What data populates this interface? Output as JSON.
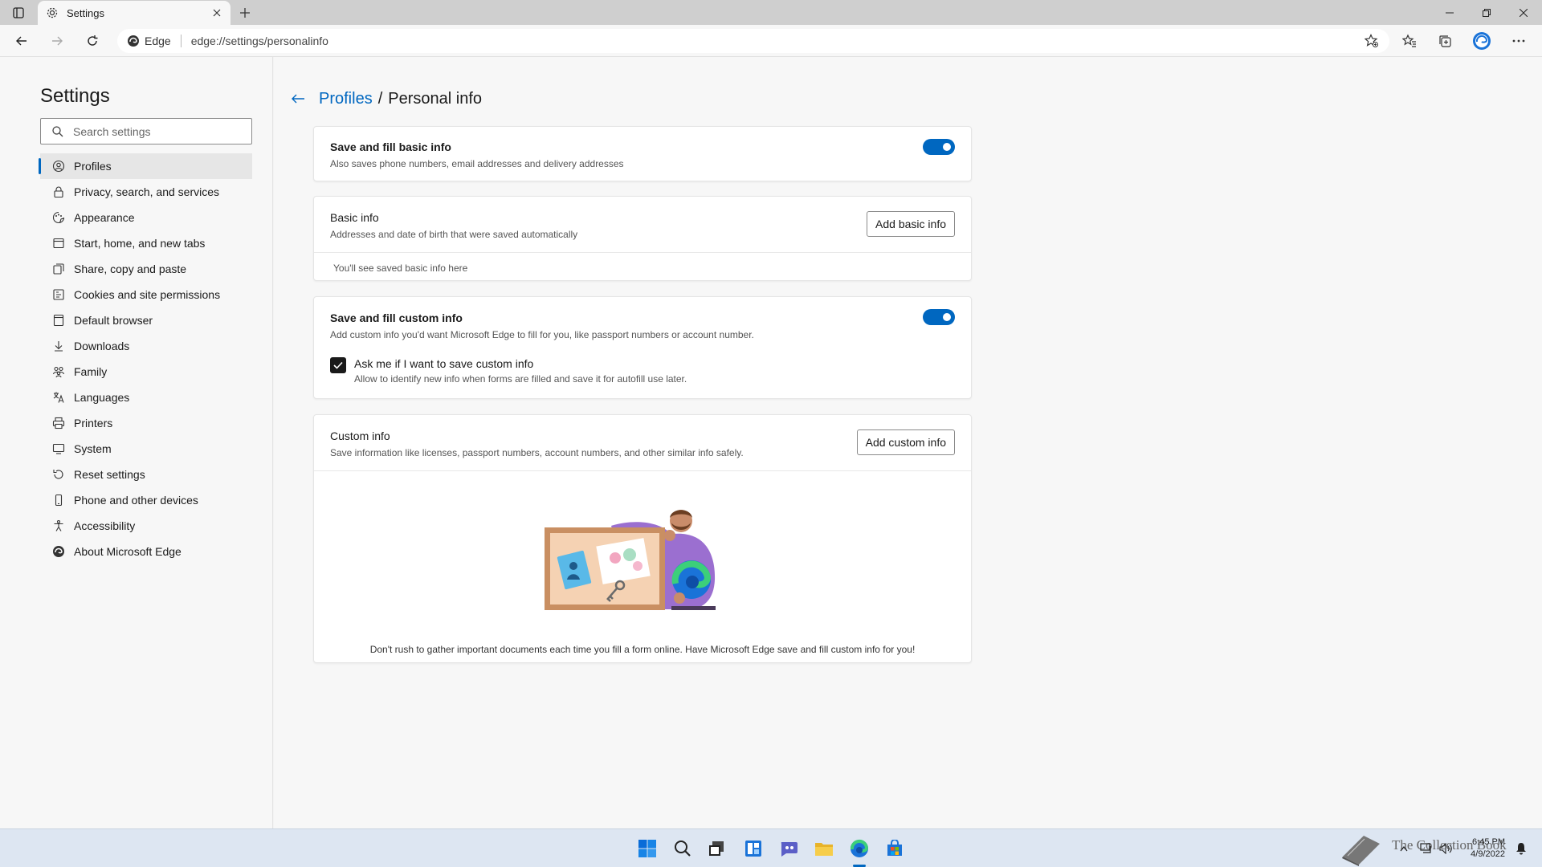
{
  "browser": {
    "tab_title": "Settings",
    "site_label": "Edge",
    "url": "edge://settings/personalinfo"
  },
  "sidebar": {
    "title": "Settings",
    "search_placeholder": "Search settings",
    "items": [
      {
        "label": "Profiles",
        "icon": "profile-icon",
        "active": true
      },
      {
        "label": "Privacy, search, and services",
        "icon": "lock-icon"
      },
      {
        "label": "Appearance",
        "icon": "appearance-icon"
      },
      {
        "label": "Start, home, and new tabs",
        "icon": "home-icon"
      },
      {
        "label": "Share, copy and paste",
        "icon": "share-icon"
      },
      {
        "label": "Cookies and site permissions",
        "icon": "cookies-icon"
      },
      {
        "label": "Default browser",
        "icon": "browser-icon"
      },
      {
        "label": "Downloads",
        "icon": "download-icon"
      },
      {
        "label": "Family",
        "icon": "family-icon"
      },
      {
        "label": "Languages",
        "icon": "languages-icon"
      },
      {
        "label": "Printers",
        "icon": "printer-icon"
      },
      {
        "label": "System",
        "icon": "system-icon"
      },
      {
        "label": "Reset settings",
        "icon": "reset-icon"
      },
      {
        "label": "Phone and other devices",
        "icon": "phone-icon"
      },
      {
        "label": "Accessibility",
        "icon": "accessibility-icon"
      },
      {
        "label": "About Microsoft Edge",
        "icon": "edge-logo-icon"
      }
    ]
  },
  "breadcrumb": {
    "parent": "Profiles",
    "separator": "/",
    "current": "Personal info"
  },
  "basic_fill": {
    "title": "Save and fill basic info",
    "desc": "Also saves phone numbers, email addresses and delivery addresses",
    "enabled": true
  },
  "basic_info": {
    "title": "Basic info",
    "desc": "Addresses and date of birth that were saved automatically",
    "button": "Add basic info",
    "empty": "You'll see saved basic info here"
  },
  "custom_fill": {
    "title": "Save and fill custom info",
    "desc": "Add custom info you'd want Microsoft Edge to fill for you, like passport numbers or account number.",
    "enabled": true,
    "ask_label": "Ask me if I want to save custom info",
    "ask_desc": "Allow to identify new info when forms are filled and save it for autofill use later.",
    "ask_checked": true
  },
  "custom_info": {
    "title": "Custom info",
    "desc": "Save information like licenses, passport numbers, account numbers, and other similar info safely.",
    "button": "Add custom info",
    "footer": "Don't rush to gather important documents each time you fill a form online. Have Microsoft Edge save and fill custom info for you!"
  },
  "taskbar": {
    "time": "6:45 PM",
    "date": "4/9/2022",
    "watermark": "The Collection Book"
  },
  "colors": {
    "accent": "#0067c0",
    "taskbar": "#dde6f2"
  }
}
